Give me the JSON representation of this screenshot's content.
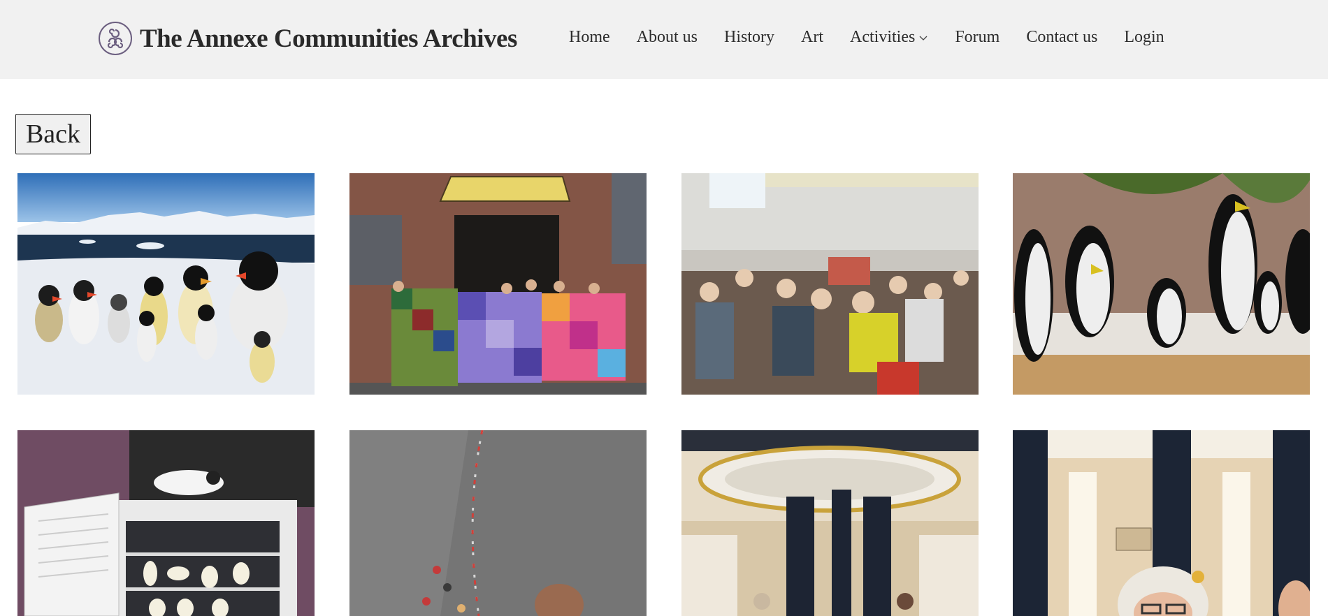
{
  "header": {
    "site_title": "The Annexe Communities Archives",
    "logo_icon": "triple-spiral-logo-icon",
    "nav": [
      {
        "label": "Home"
      },
      {
        "label": "About us"
      },
      {
        "label": "History"
      },
      {
        "label": "Art"
      },
      {
        "label": "Activities",
        "has_dropdown": true
      },
      {
        "label": "Forum"
      },
      {
        "label": "Contact us"
      },
      {
        "label": "Login"
      }
    ]
  },
  "page": {
    "back_label": "Back"
  },
  "gallery": {
    "photos": [
      {
        "subject": "knitted-penguins-antarctic-scene"
      },
      {
        "subject": "group-holding-patchwork-blankets-outside-annexe"
      },
      {
        "subject": "hall-group-holding-up-knitted-penguins"
      },
      {
        "subject": "knitted-penguins-on-windowsill"
      },
      {
        "subject": "knitted-penguins-in-fridge"
      },
      {
        "subject": "aerial-view-of-road"
      },
      {
        "subject": "ship-interior-with-columns"
      },
      {
        "subject": "woman-in-ship-interior"
      }
    ]
  },
  "colors": {
    "header_bg": "#f1f1f1",
    "text": "#2a2a2a",
    "logo": "#6c5f80"
  }
}
